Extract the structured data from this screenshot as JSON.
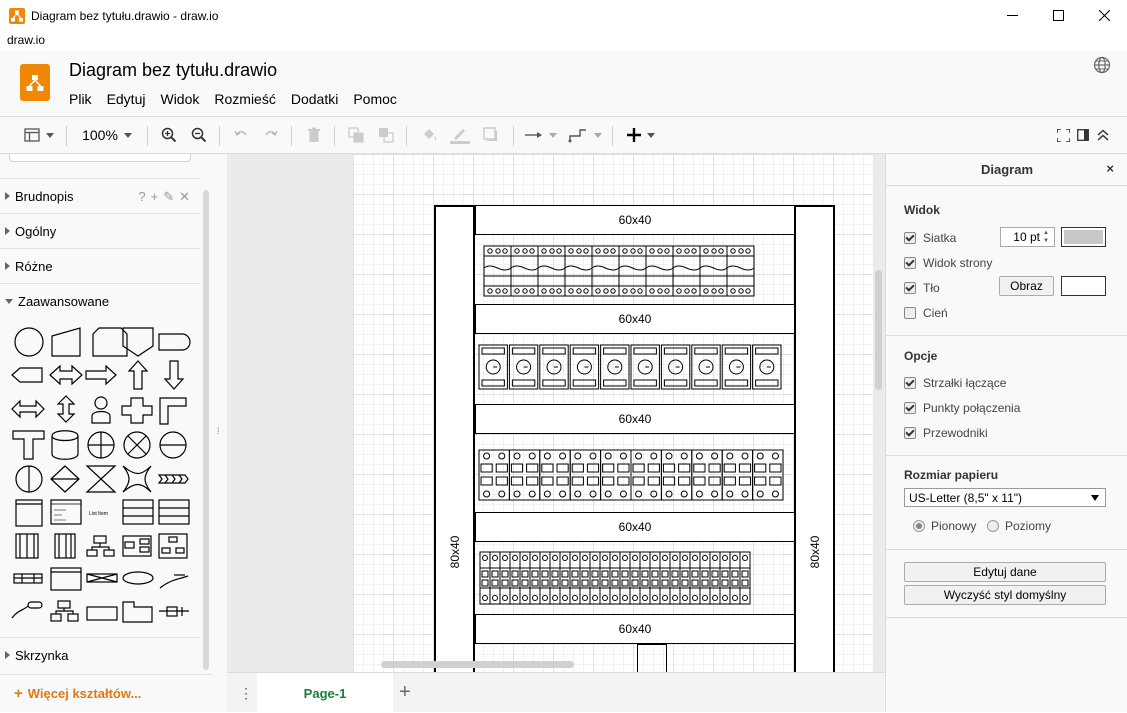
{
  "window": {
    "title": "Diagram bez tytułu.drawio - draw.io",
    "os_menu_label": "draw.io"
  },
  "header": {
    "document_title": "Diagram bez tytułu.drawio",
    "menu": [
      "Plik",
      "Edytuj",
      "Widok",
      "Rozmieść",
      "Dodatki",
      "Pomoc"
    ]
  },
  "toolbar": {
    "zoom": "100%",
    "icons": [
      "format-icon",
      "zoom-in-icon",
      "zoom-out-icon",
      "undo-icon",
      "redo-icon",
      "delete-icon",
      "to-front-icon",
      "to-back-icon",
      "fill-color-icon",
      "line-color-icon",
      "shadow-icon",
      "connection-icon",
      "waypoints-icon",
      "insert-icon",
      "fullscreen-icon",
      "format-panel-icon",
      "collapse-icon"
    ]
  },
  "sidebar": {
    "sections": [
      {
        "label": "Brudnopis",
        "expanded": false,
        "tools": [
          "?",
          "+",
          "✎",
          "✕"
        ]
      },
      {
        "label": "Ogólny",
        "expanded": false
      },
      {
        "label": "Różne",
        "expanded": false
      },
      {
        "label": "Zaawansowane",
        "expanded": true
      },
      {
        "label": "Skrzynka",
        "expanded": false
      }
    ],
    "more_shapes": "Więcej kształtów..."
  },
  "canvas": {
    "post_label": "80x40",
    "rows": [
      {
        "kind": "rail",
        "label": "60x40"
      },
      {
        "kind": "strip",
        "style": "breakers",
        "modules": 10
      },
      {
        "kind": "rail",
        "label": "60x40"
      },
      {
        "kind": "strip",
        "style": "dials",
        "modules": 10
      },
      {
        "kind": "rail",
        "label": "60x40"
      },
      {
        "kind": "strip",
        "style": "double-terminal",
        "modules": 10
      },
      {
        "kind": "rail",
        "label": "60x40"
      },
      {
        "kind": "strip",
        "style": "fine-terminal",
        "modules": 27
      },
      {
        "kind": "rail",
        "label": "60x40"
      }
    ]
  },
  "pages": {
    "tabs": [
      "Page-1"
    ],
    "add_label": "+"
  },
  "format_panel": {
    "title": "Diagram",
    "close": "×",
    "view": {
      "title": "Widok",
      "grid_label": "Siatka",
      "grid_checked": true,
      "grid_size": "10 pt",
      "grid_color": "#c8c8c8",
      "page_view_label": "Widok strony",
      "page_view_checked": true,
      "background_label": "Tło",
      "background_checked": true,
      "background_button": "Obraz",
      "background_color": "#ffffff",
      "shadow_label": "Cień",
      "shadow_checked": false
    },
    "options": {
      "title": "Opcje",
      "items": [
        {
          "label": "Strzałki łączące",
          "checked": true
        },
        {
          "label": "Punkty połączenia",
          "checked": true
        },
        {
          "label": "Przewodniki",
          "checked": true
        }
      ]
    },
    "paper": {
      "title": "Rozmiar papieru",
      "selected": "US-Letter (8,5\" x 11\")",
      "portrait": "Pionowy",
      "landscape": "Poziomy",
      "portrait_selected": true
    },
    "buttons": {
      "edit_data": "Edytuj dane",
      "clear_style": "Wyczyść styl domyślny"
    }
  },
  "colors": {
    "accent_orange": "#f08705",
    "page_tab_green": "#1b7f3b",
    "more_shapes_orange": "#e07a10"
  }
}
